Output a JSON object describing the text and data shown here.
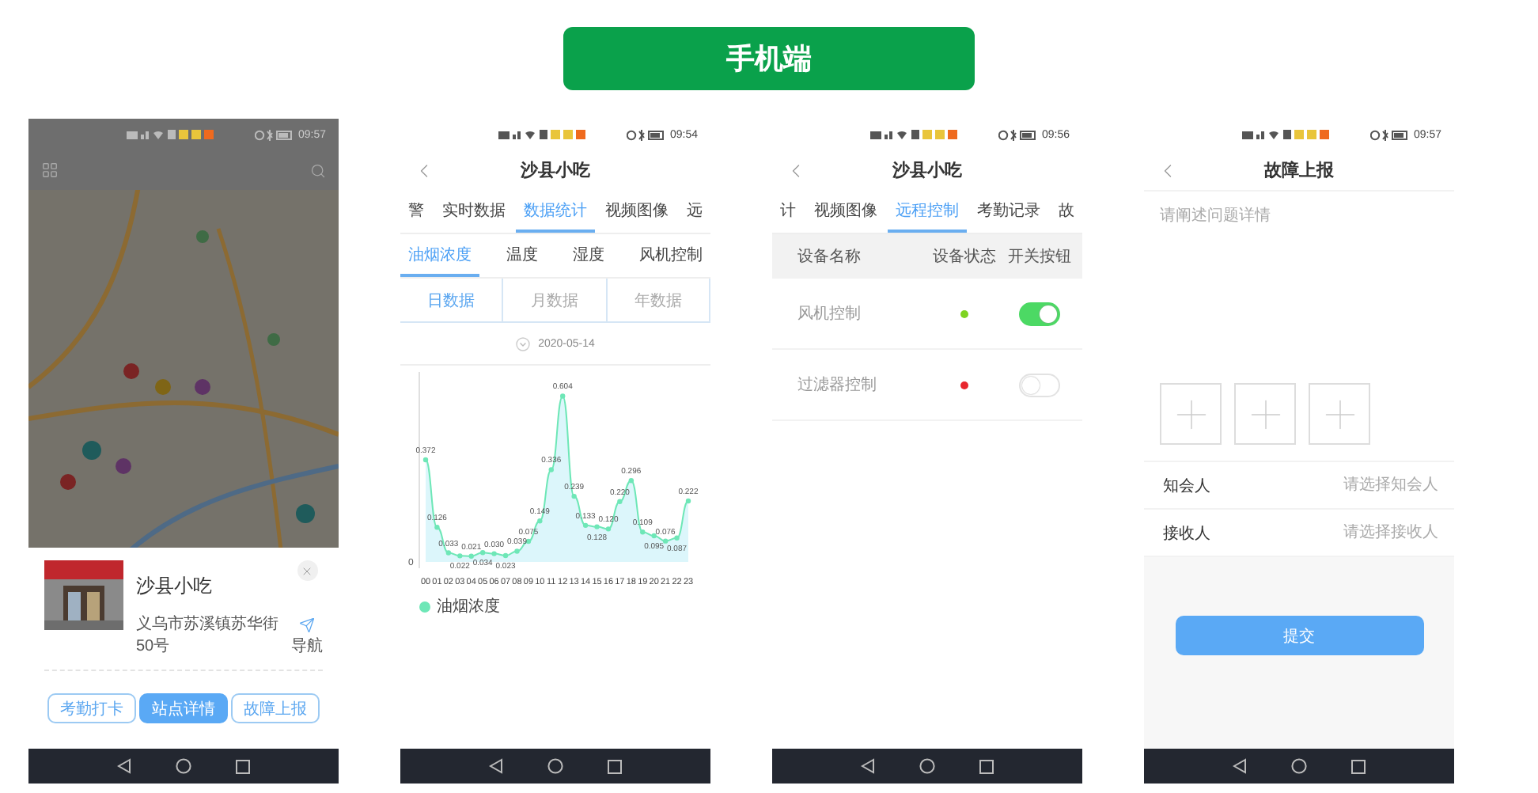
{
  "banner": {
    "title": "手机端"
  },
  "phones": [
    {
      "kind": "map",
      "time": "09:57",
      "card": {
        "title": "沙县小吃",
        "address": "义乌市苏溪镇苏华街50号",
        "nav_label": "导航"
      },
      "buttons": [
        {
          "label": "考勤打卡",
          "kind": "outline"
        },
        {
          "label": "站点详情",
          "kind": "primary"
        },
        {
          "label": "故障上报",
          "kind": "outline"
        }
      ]
    },
    {
      "kind": "stats",
      "time": "09:54",
      "title": "沙县小吃",
      "tabs": [
        {
          "label": "警",
          "selected": false
        },
        {
          "label": "实时数据",
          "selected": false
        },
        {
          "label": "数据统计",
          "selected": true
        },
        {
          "label": "视频图像",
          "selected": false
        },
        {
          "label": "远",
          "selected": false
        }
      ],
      "subtabs": [
        {
          "label": "油烟浓度",
          "selected": true
        },
        {
          "label": "温度",
          "selected": false
        },
        {
          "label": "湿度",
          "selected": false
        },
        {
          "label": "风机控制",
          "selected": false
        }
      ],
      "periods": [
        {
          "label": "日数据",
          "selected": true
        },
        {
          "label": "月数据",
          "selected": false
        },
        {
          "label": "年数据",
          "selected": false
        }
      ],
      "date": "2020-05-14",
      "chart_data": {
        "type": "area",
        "categories": [
          "00",
          "01",
          "02",
          "03",
          "04",
          "05",
          "06",
          "07",
          "08",
          "09",
          "10",
          "11",
          "12",
          "13",
          "14",
          "15",
          "16",
          "17",
          "18",
          "19",
          "20",
          "21",
          "22",
          "23"
        ],
        "annotations": [
          "0"
        ],
        "data_labels": true,
        "series": [
          {
            "name": "油烟浓度",
            "color": "#6ee7b7",
            "values": [
              0.372,
              0.126,
              0.033,
              0.022,
              0.021,
              0.034,
              0.03,
              0.023,
              0.039,
              0.075,
              0.149,
              0.336,
              0.604,
              0.239,
              0.133,
              0.128,
              0.12,
              0.22,
              0.296,
              0.109,
              0.095,
              0.076,
              0.087,
              0.222
            ],
            "value_labels": [
              "0.372",
              "0.126",
              "0.033",
              "0.022",
              "0.021",
              "0.034",
              "0.030",
              "0.023",
              "0.039",
              "0.075",
              "0.149",
              "0.336",
              "0.604",
              "0.239",
              "0.133",
              "0.128",
              "0.120",
              "0.220",
              "0.296",
              "0.109",
              "0.095",
              "0.076",
              "0.087",
              "0.222"
            ]
          }
        ]
      }
    },
    {
      "kind": "control",
      "time": "09:56",
      "title": "沙县小吃",
      "tabs": [
        {
          "label": "计",
          "selected": false
        },
        {
          "label": "视频图像",
          "selected": false
        },
        {
          "label": "远程控制",
          "selected": true
        },
        {
          "label": "考勤记录",
          "selected": false
        },
        {
          "label": "故",
          "selected": false
        }
      ],
      "columns": [
        "设备名称",
        "设备状态",
        "开关按钮"
      ],
      "devices": [
        {
          "name": "风机控制",
          "color": "#7ed321",
          "on": true
        },
        {
          "name": "过滤器控制",
          "color": "#e8262e",
          "on": false
        }
      ]
    },
    {
      "kind": "report",
      "time": "09:57",
      "title": "故障上报",
      "placeholder": "请阐述问题详情",
      "fields": [
        {
          "label": "知会人",
          "placeholder": "请选择知会人"
        },
        {
          "label": "接收人",
          "placeholder": "请选择接收人"
        }
      ],
      "submit": "提交"
    }
  ]
}
